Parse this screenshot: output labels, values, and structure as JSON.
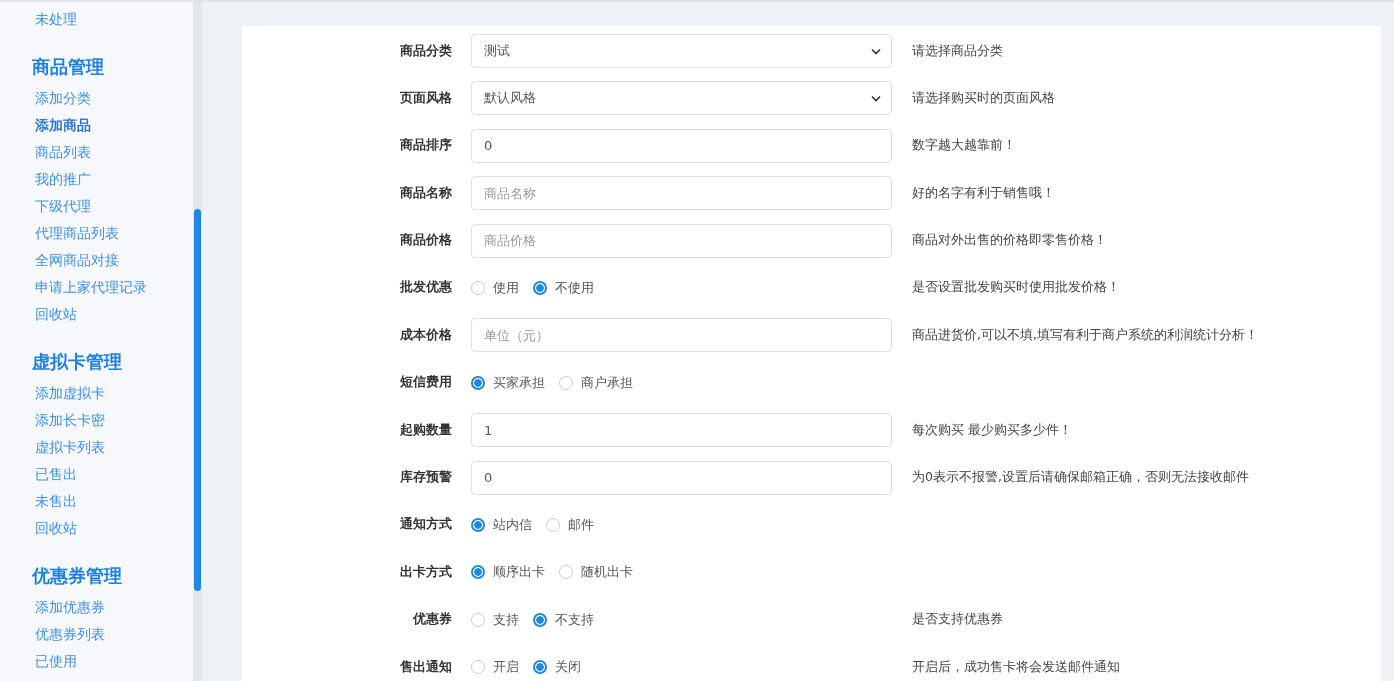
{
  "sidebar": {
    "sections": [
      {
        "items": [
          {
            "label": "未处理",
            "selected": false
          }
        ]
      },
      {
        "title": "商品管理",
        "items": [
          {
            "label": "添加分类",
            "selected": false
          },
          {
            "label": "添加商品",
            "selected": true
          },
          {
            "label": "商品列表",
            "selected": false
          },
          {
            "label": "我的推广",
            "selected": false
          },
          {
            "label": "下级代理",
            "selected": false
          },
          {
            "label": "代理商品列表",
            "selected": false
          },
          {
            "label": "全网商品对接",
            "selected": false
          },
          {
            "label": "申请上家代理记录",
            "selected": false
          },
          {
            "label": "回收站",
            "selected": false
          }
        ]
      },
      {
        "title": "虚拟卡管理",
        "items": [
          {
            "label": "添加虚拟卡",
            "selected": false
          },
          {
            "label": "添加长卡密",
            "selected": false
          },
          {
            "label": "虚拟卡列表",
            "selected": false
          },
          {
            "label": "已售出",
            "selected": false
          },
          {
            "label": "未售出",
            "selected": false
          },
          {
            "label": "回收站",
            "selected": false
          }
        ]
      },
      {
        "title": "优惠券管理",
        "items": [
          {
            "label": "添加优惠券",
            "selected": false
          },
          {
            "label": "优惠券列表",
            "selected": false
          },
          {
            "label": "已使用",
            "selected": false
          }
        ]
      }
    ]
  },
  "form": {
    "rows": [
      {
        "label": "商品分类",
        "kind": "select",
        "value": "测试",
        "help": "请选择商品分类"
      },
      {
        "label": "页面风格",
        "kind": "select",
        "value": "默认风格",
        "help": "请选择购买时的页面风格"
      },
      {
        "label": "商品排序",
        "kind": "input",
        "value": "0",
        "help": "数字越大越靠前！"
      },
      {
        "label": "商品名称",
        "kind": "input",
        "placeholder": "商品名称",
        "help": "好的名字有利于销售哦！"
      },
      {
        "label": "商品价格",
        "kind": "input",
        "placeholder": "商品价格",
        "help": "商品对外出售的价格即零售价格！"
      },
      {
        "label": "批发优惠",
        "kind": "radio",
        "options": [
          {
            "label": "使用",
            "selected": false
          },
          {
            "label": "不使用",
            "selected": true
          }
        ],
        "help": "是否设置批发购买时使用批发价格！"
      },
      {
        "label": "成本价格",
        "kind": "input",
        "placeholder": "单位（元）",
        "help": "商品进货价,可以不填,填写有利于商户系统的利润统计分析！"
      },
      {
        "label": "短信费用",
        "kind": "radio",
        "options": [
          {
            "label": "买家承担",
            "selected": true
          },
          {
            "label": "商户承担",
            "selected": false
          }
        ]
      },
      {
        "label": "起购数量",
        "kind": "input",
        "value": "1",
        "help": "每次购买 最少购买多少件！"
      },
      {
        "label": "库存预警",
        "kind": "input",
        "value": "0",
        "help": "为0表示不报警,设置后请确保邮箱正确，否则无法接收邮件"
      },
      {
        "label": "通知方式",
        "kind": "radio",
        "options": [
          {
            "label": "站内信",
            "selected": true
          },
          {
            "label": "邮件",
            "selected": false
          }
        ]
      },
      {
        "label": "出卡方式",
        "kind": "radio",
        "options": [
          {
            "label": "顺序出卡",
            "selected": true
          },
          {
            "label": "随机出卡",
            "selected": false
          }
        ]
      },
      {
        "label": "优惠券",
        "kind": "radio",
        "options": [
          {
            "label": "支持",
            "selected": false
          },
          {
            "label": "不支持",
            "selected": true
          }
        ],
        "help": "是否支持优惠券"
      },
      {
        "label": "售出通知",
        "kind": "radio",
        "options": [
          {
            "label": "开启",
            "selected": false
          },
          {
            "label": "关闭",
            "selected": true
          }
        ],
        "help": "开启后，成功售卡将会发送邮件通知"
      }
    ]
  }
}
